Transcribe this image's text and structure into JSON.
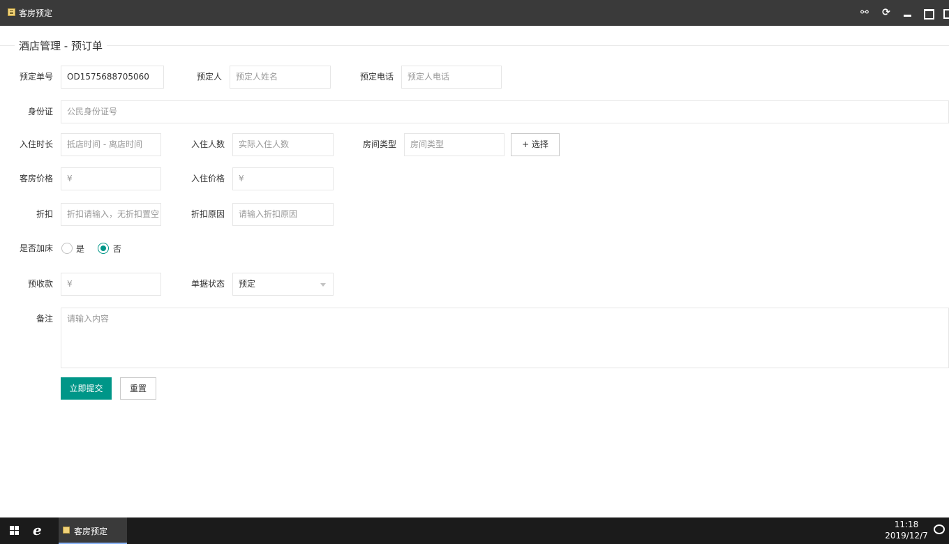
{
  "window": {
    "title": "客房预定",
    "controls": [
      "link-icon",
      "refresh-icon",
      "minimize-icon",
      "maximize-icon",
      "close-icon"
    ]
  },
  "section": {
    "legend": "酒店管理 - 预订单"
  },
  "form": {
    "order_no": {
      "label": "预定单号",
      "value": "OD1575688705060"
    },
    "booker": {
      "label": "预定人",
      "placeholder": "预定人姓名"
    },
    "phone": {
      "label": "预定电话",
      "placeholder": "预定人电话"
    },
    "id_card": {
      "label": "身份证",
      "placeholder": "公民身份证号"
    },
    "stay_period": {
      "label": "入住时长",
      "placeholder": "抵店时间 - 离店时间"
    },
    "guest_count": {
      "label": "入住人数",
      "placeholder": "实际入住人数"
    },
    "room_type": {
      "label": "房间类型",
      "placeholder": "房间类型",
      "select_button": "+ 选择"
    },
    "room_price": {
      "label": "客房价格",
      "placeholder": "¥"
    },
    "checkin_price": {
      "label": "入住价格",
      "placeholder": "¥"
    },
    "discount": {
      "label": "折扣",
      "placeholder": "折扣请输入，无折扣置空"
    },
    "discount_reason": {
      "label": "折扣原因",
      "placeholder": "请输入折扣原因"
    },
    "extra_bed": {
      "label": "是否加床",
      "options": [
        {
          "label": "是",
          "checked": false
        },
        {
          "label": "否",
          "checked": true
        }
      ]
    },
    "deposit": {
      "label": "预收款",
      "placeholder": "¥"
    },
    "status": {
      "label": "单据状态",
      "value": "预定"
    },
    "remark": {
      "label": "备注",
      "placeholder": "请输入内容"
    },
    "submit_label": "立即提交",
    "reset_label": "重置"
  },
  "taskbar": {
    "app_label": "客房预定",
    "time": "11:18",
    "date": "2019/12/7"
  },
  "colors": {
    "primary": "#009688",
    "titlebar": "#3a3a3a",
    "taskbar": "#1b1b1b"
  }
}
